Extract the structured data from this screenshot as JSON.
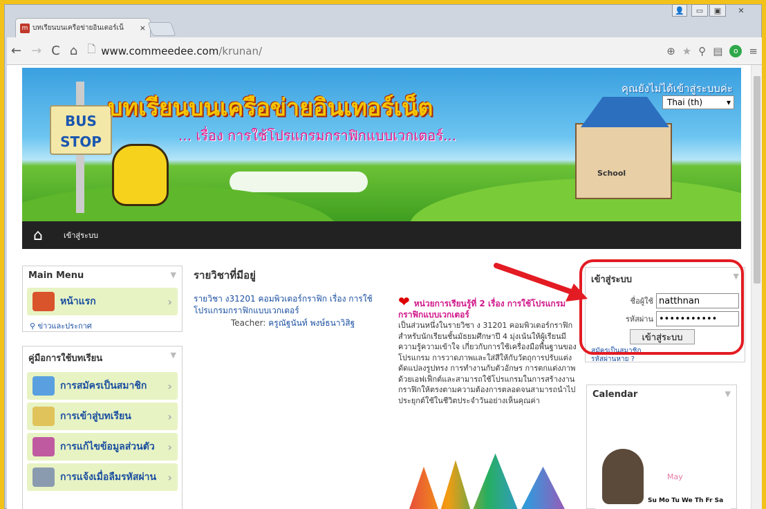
{
  "browser": {
    "tab_title": "บทเรียนบนเครือข่ายอินเตอร์เน็",
    "tab_close": "×",
    "url_host": "www.commeedee.com",
    "url_path": "/krunan/"
  },
  "banner": {
    "title": "บทเรียนบนเครือข่ายอินเทอร์เน็ต",
    "subtitle": "... เรื่อง การใช้โปรแกรมกราฟิกแบบเวกเตอร์...",
    "bus_sign_1": "BUS",
    "bus_sign_2": "STOP",
    "school_sign": "School",
    "not_logged_in": "คุณยังไม่ได้เข้าสู่ระบบค่ะ",
    "language": "Thai (th)"
  },
  "navbar": {
    "login": "เข้าสู่ระบบ"
  },
  "main_menu": {
    "title": "Main Menu",
    "home": "หน้าแรก",
    "news": "ข่าวและประกาศ"
  },
  "guide": {
    "title": "คู่มือการใช้บทเรียน",
    "items": [
      "การสมัครเป็นสมาชิก",
      "การเข้าสู่บทเรียน",
      "การแก้ไขข้อมูลส่วนตัว",
      "การแจ้งเมื่อลืมรหัสผ่าน"
    ]
  },
  "center": {
    "heading": "รายวิชาที่มีอยู่",
    "course": "รายวิชา ง31201 คอมพิวเตอร์กราฟิก เรื่อง การใช้โปรแกรมกราฟิกแบบเวกเตอร์",
    "teacher_label": "Teacher:",
    "teacher": "ครูณัฐนันท์ พงษ์ธนาวิสิฐ",
    "unit_title": "หน่วยการเรียนรู้ที่ 2 เรื่อง การใช้โปรแกรมกราฟิกแบบเวกเตอร์",
    "unit_desc": "เป็นส่วนหนึ่งในรายวิชา ง 31201 คอมพิวเตอร์กราฟิก สำหรับนักเรียนชั้นมัธยมศึกษาปี 4 มุ่งเน้นให้ผู้เรียนมีความรู้ความเข้าใจ เกี่ยวกับการใช้เครื่องมือพื้นฐานของโปรแกรม การวาดภาพและใส่สีให้กับวัตถุการปรับแต่ง ดัดแปลงรูปทรง การทำงานกับตัวอักษร การตกแต่งภาพด้วยเอฟเฟ็กต์และสามารถใช้โปรแกรมในการสร้างงานกราฟิกให้ตรงตามความต้องการตลอดจนสามารถนำไปประยุกต์ใช้ในชีวิตประจำวันอย่างเห็นคุณค่า"
  },
  "login": {
    "title": "เข้าสู่ระบบ",
    "user_label": "ชื่อผู้ใช้",
    "user_value": "natthnan",
    "pass_label": "รหัสผ่าน",
    "pass_value": "•••••••••••",
    "button": "เข้าสู่ระบบ",
    "signup": "สมัครเป็นสมาชิก",
    "forgot": "รหัสผ่านหาย ?"
  },
  "calendar": {
    "title": "Calendar",
    "month": "May",
    "days": "Su Mo Tu We Th Fr Sa"
  },
  "colors": {
    "accent": "#e31b23",
    "link": "#1a4fa0",
    "magenta": "#d0178a"
  }
}
